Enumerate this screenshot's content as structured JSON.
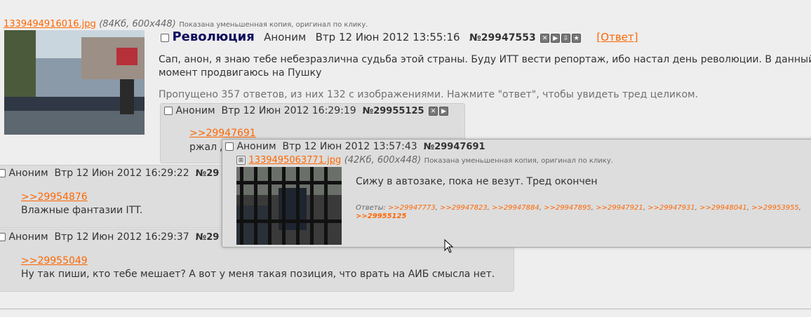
{
  "op": {
    "file_link": "1339494916016.jpg",
    "file_meta": "(84Кб, 600x448)",
    "file_note": "Показана уменьшенная копия, оригинал по клику.",
    "subject": "Революция",
    "author": "Аноним",
    "date": "Втр 12 Июн 2012 13:55:16",
    "number": "№29947553",
    "reply_open": "[",
    "reply_label": "Ответ",
    "reply_close": "]",
    "message_line1": "Сап, анон, я знаю тебе небезразлична судьба этой страны. Буду ИТТ вести репортаж, ибо настал день революции. В данный",
    "message_line2": "момент продвигаюсь на Пушку",
    "omitted": "Пропущено 357 ответов, из них 132 с изображениями. Нажмите \"ответ\", чтобы увидеть тред целиком."
  },
  "posts": [
    {
      "author": "Аноним",
      "date": "Втр 12 Июн 2012 16:29:19",
      "number": "№29955125",
      "quote": ">>29947691",
      "text": "ржал д"
    },
    {
      "author": "Аноним",
      "date": "Втр 12 Июн 2012 16:29:22",
      "number": "№29",
      "quote": ">>29954876",
      "text": "Влажные фантазии ITT."
    },
    {
      "author": "Аноним",
      "date": "Втр 12 Июн 2012 16:29:37",
      "number": "№29",
      "quote": ">>29955049",
      "text": "Ну так пиши, кто тебе мешает? А вот у меня такая позиция, что врать на АИБ смысла нет."
    }
  ],
  "popup": {
    "author": "Аноним",
    "date": "Втр 12 Июн 2012 13:57:43",
    "number": "№29947691",
    "file_link": "1339495063771.jpg",
    "file_meta": "(42Кб, 600x448)",
    "file_note": "Показана уменьшенная копия, оригинал по клику.",
    "message": "Сижу в автозаке, пока не везут. Тред окончен",
    "replies_label": "Ответы:",
    "replies": [
      ">>29947773",
      ">>29947823",
      ">>29947884",
      ">>29947895",
      ">>29947921",
      ">>29947931",
      ">>29948041",
      ">>29953955"
    ],
    "reply_last": ">>29955125"
  },
  "colors": {
    "link": "#ff6600",
    "subject": "#0f0c5d",
    "background": "#eeeeee",
    "post_bg": "#dddddd"
  }
}
